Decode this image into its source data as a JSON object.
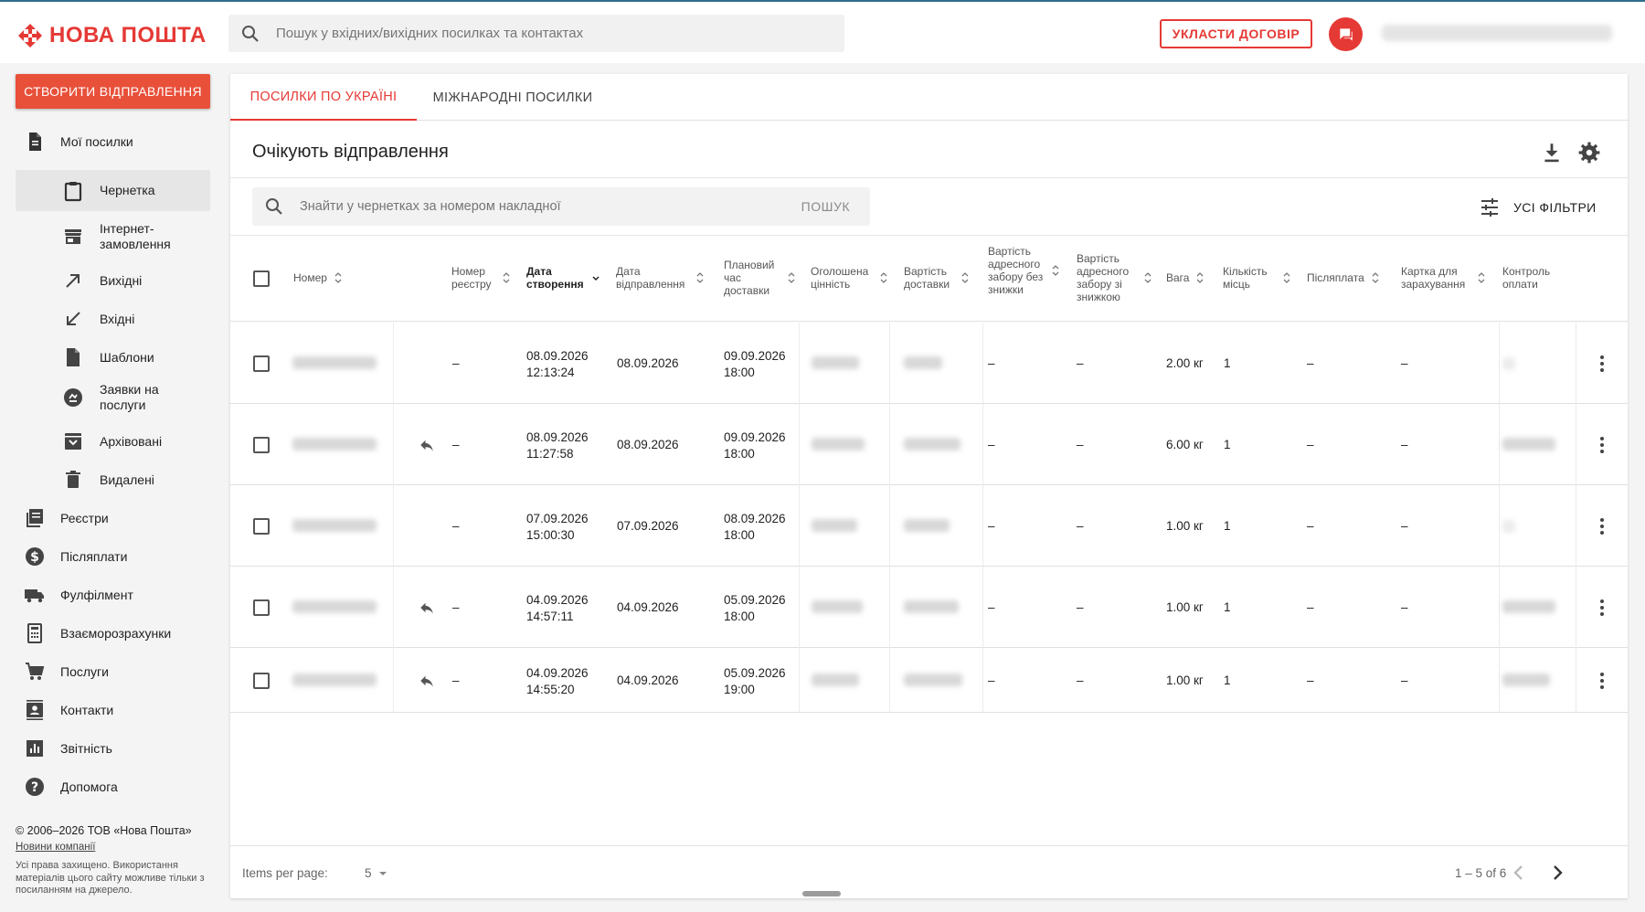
{
  "header": {
    "logo_text": "НОВА ПОШТА",
    "search_placeholder": "Пошук у вхідних/вихідних посилках та контактах",
    "contract_button": "УКЛАСТИ ДОГОВІР",
    "accent_color": "#e53935"
  },
  "sidebar": {
    "create_button": "СТВОРИТИ ВІДПРАВЛЕННЯ",
    "my_parcels": "Мої посилки",
    "sub_items": [
      {
        "label": "Чернетка",
        "icon": "clipboard-icon",
        "active": true
      },
      {
        "label": "Інтернет-замовлення",
        "icon": "store-icon"
      },
      {
        "label": "Вихідні",
        "icon": "arrow-up-right-icon"
      },
      {
        "label": "Вхідні",
        "icon": "arrow-down-left-icon"
      },
      {
        "label": "Шаблони",
        "icon": "file-icon"
      },
      {
        "label": "Заявки на послуги",
        "icon": "service-request-icon"
      },
      {
        "label": "Архівовані",
        "icon": "archive-icon"
      },
      {
        "label": "Видалені",
        "icon": "trash-icon"
      }
    ],
    "items": [
      {
        "label": "Реєстри",
        "icon": "registry-icon"
      },
      {
        "label": "Післяплати",
        "icon": "dollar-icon"
      },
      {
        "label": "Фулфілмент",
        "icon": "truck-icon"
      },
      {
        "label": "Взаєморозрахунки",
        "icon": "calculator-icon"
      },
      {
        "label": "Послуги",
        "icon": "cart-icon"
      },
      {
        "label": "Контакти",
        "icon": "contacts-icon"
      },
      {
        "label": "Звітність",
        "icon": "chart-icon"
      },
      {
        "label": "Допомога",
        "icon": "help-icon"
      }
    ],
    "footer": {
      "copyright": "© 2006–2026 ТОВ «Нова Пошта»",
      "news_link": "Новини компанії",
      "rights": "Усі права захищено. Використання матеріалів цього сайту можливе тільки з посиланням на джерело."
    }
  },
  "main": {
    "tabs": [
      {
        "label": "ПОСИЛКИ ПО УКРАЇНІ",
        "active": true
      },
      {
        "label": "МІЖНАРОДНІ ПОСИЛКИ",
        "active": false
      }
    ],
    "title": "Очікують відправлення",
    "search_placeholder": "Знайти у чернетках за номером накладної",
    "search_button": "ПОШУК",
    "filters_button": "УСІ ФІЛЬТРИ",
    "columns": {
      "number": "Номер",
      "registry": "Номер реєстру",
      "created": "Дата створення",
      "sent": "Дата відправлення",
      "planned": "Плановий час доставки",
      "declared": "Оголошена цінність",
      "delivery_cost": "Вартість доставки",
      "pickup_no_discount": "Вартість адресного забору без знижки",
      "pickup_discount": "Вартість адресного забору зі знижкою",
      "weight": "Вага",
      "places": "Кількість місць",
      "cod": "Післяплата",
      "card": "Картка для зарахування",
      "payment_control": "Контроль оплати"
    },
    "rows": [
      {
        "registry": "–",
        "created_date": "08.09.2026",
        "created_time": "12:13:24",
        "sent": "08.09.2026",
        "planned_date": "09.09.2026",
        "planned_time": "18:00",
        "pickup1": "–",
        "pickup2": "–",
        "weight": "2.00 кг",
        "places": "1",
        "cod": "–",
        "card": "–"
      },
      {
        "registry": "–",
        "created_date": "08.09.2026",
        "created_time": "11:27:58",
        "sent": "08.09.2026",
        "planned_date": "09.09.2026",
        "planned_time": "18:00",
        "pickup1": "–",
        "pickup2": "–",
        "weight": "6.00 кг",
        "places": "1",
        "cod": "–",
        "card": "–"
      },
      {
        "registry": "–",
        "created_date": "07.09.2026",
        "created_time": "15:00:30",
        "sent": "07.09.2026",
        "planned_date": "08.09.2026",
        "planned_time": "18:00",
        "pickup1": "–",
        "pickup2": "–",
        "weight": "1.00 кг",
        "places": "1",
        "cod": "–",
        "card": "–"
      },
      {
        "registry": "–",
        "created_date": "04.09.2026",
        "created_time": "14:57:11",
        "sent": "04.09.2026",
        "planned_date": "05.09.2026",
        "planned_time": "18:00",
        "pickup1": "–",
        "pickup2": "–",
        "weight": "1.00 кг",
        "places": "1",
        "cod": "–",
        "card": "–"
      },
      {
        "registry": "–",
        "created_date": "04.09.2026",
        "created_time": "14:55:20",
        "sent": "04.09.2026",
        "planned_date": "05.09.2026",
        "planned_time": "19:00",
        "pickup1": "–",
        "pickup2": "–",
        "weight": "1.00 кг",
        "places": "1",
        "cod": "–",
        "card": "–"
      }
    ],
    "paginator": {
      "items_per_page_label": "Items per page:",
      "items_per_page": "5",
      "range": "1 – 5 of 6"
    }
  }
}
